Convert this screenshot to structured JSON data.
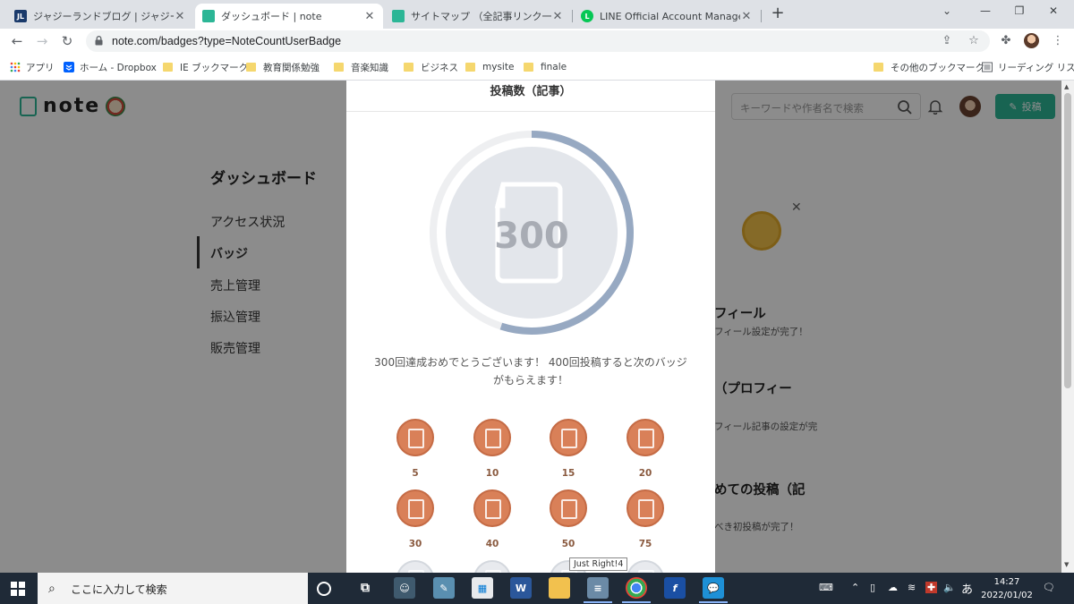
{
  "browser": {
    "tabs": [
      {
        "favicon": "JL",
        "favicon_color": "#1a3a6b",
        "label": "ジャジーランドブログ | ジャジーランドブロ"
      },
      {
        "favicon": "note",
        "favicon_color": "#2cb696",
        "label": "ダッシュボード | note"
      },
      {
        "favicon": "note",
        "favicon_color": "#2cb696",
        "label": "サイトマップ （全記事リンク一覧）"
      },
      {
        "favicon": "LINE",
        "favicon_color": "#06c755",
        "label": "LINE Official Account Manager"
      }
    ],
    "url": "note.com/badges?type=NoteCountUserBadge",
    "bookmarks": [
      "アプリ",
      "ホーム - Dropbox",
      "IE ブックマーク",
      "教育関係勉強",
      "音楽知識",
      "ビジネス",
      "mysite",
      "finale"
    ],
    "bookmarks_right": [
      "その他のブックマーク",
      "リーディング リスト"
    ]
  },
  "note": {
    "logo": "note",
    "search_placeholder": "キーワードや作者名で検索",
    "post_button": "投稿",
    "dashboard_title": "ダッシュボード",
    "sidebar": [
      {
        "label": "アクセス状況",
        "active": false
      },
      {
        "label": "バッジ",
        "active": true
      },
      {
        "label": "売上管理",
        "active": false
      },
      {
        "label": "振込管理",
        "active": false
      },
      {
        "label": "販売管理",
        "active": false
      }
    ],
    "right_fragments": [
      {
        "text": "フィール",
        "style": "big"
      },
      {
        "text": "フィール設定が完了！",
        "style": "small"
      },
      {
        "text": "（プロフィー",
        "style": "big"
      },
      {
        "text": "フィール記事の設定が完",
        "style": "small"
      },
      {
        "text": "めての投稿（記",
        "style": "big"
      },
      {
        "text": "べき初投稿が完了！",
        "style": "small"
      }
    ]
  },
  "modal": {
    "title": "投稿数（記事）",
    "badge_value": "300",
    "progress": 0.55,
    "message": "300回達成おめでとうございます！ 400回投稿すると次のバッジがもらえます！",
    "badges": [
      "5",
      "10",
      "15",
      "20",
      "30",
      "40",
      "50",
      "75"
    ],
    "colors": {
      "ring_progress": "#97a9c2",
      "ring_track": "#eeeff1",
      "badge_copper": "#d98058"
    }
  },
  "tooltip": "Just Right!4",
  "taskbar": {
    "search_placeholder": "ここに入力して検索",
    "ime": "あ",
    "time": "14:27",
    "date": "2022/01/02"
  }
}
